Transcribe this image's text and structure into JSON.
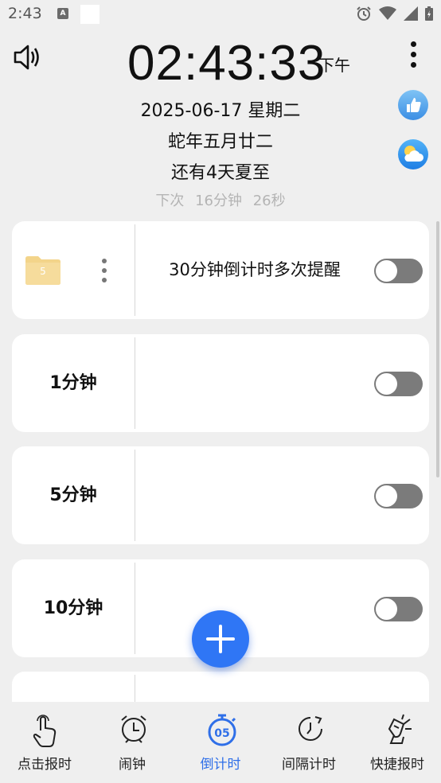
{
  "status_bar": {
    "time": "2:43",
    "notification_letter": "A"
  },
  "clock": {
    "time": "02:43:33",
    "ampm": "下午"
  },
  "date_info": {
    "date": "2025-06-17 星期二",
    "lunar": "蛇年五月廿二",
    "solar_term": "还有4天夏至"
  },
  "next_chime": {
    "label": "下次",
    "minutes": "16分钟",
    "seconds": "26秒"
  },
  "cards": [
    {
      "label": "",
      "title": "30分钟倒计时多次提醒",
      "folder_number": "5",
      "enabled": false
    },
    {
      "label": "1分钟",
      "title": "",
      "enabled": false
    },
    {
      "label": "5分钟",
      "title": "",
      "enabled": false
    },
    {
      "label": "10分钟",
      "title": "",
      "enabled": false
    }
  ],
  "bottom_nav": [
    {
      "label": "点击报时",
      "icon": "tap-hand-icon",
      "active": false
    },
    {
      "label": "闹钟",
      "icon": "alarm-clock-icon",
      "active": false
    },
    {
      "label": "倒计时",
      "icon": "countdown-timer-icon",
      "active": true
    },
    {
      "label": "间隔计时",
      "icon": "interval-timer-icon",
      "active": false
    },
    {
      "label": "快捷报时",
      "icon": "quick-announce-icon",
      "active": false
    }
  ],
  "colors": {
    "accent": "#2f76f5",
    "toggle_off": "#7b7b7b",
    "folder": "#f3d48a"
  }
}
